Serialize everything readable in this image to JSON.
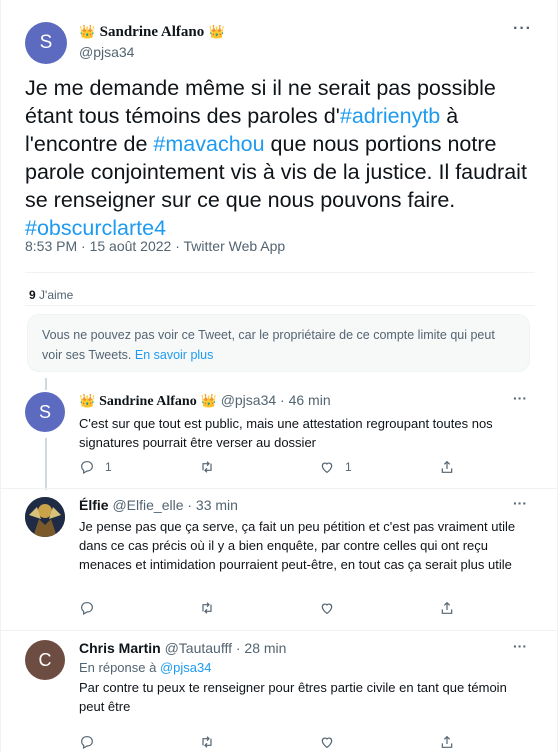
{
  "main_tweet": {
    "avatar_letter": "S",
    "display_name": "Sandrine Alfano",
    "crown_left": "👑",
    "crown_right": "👑",
    "handle": "@pjsa34",
    "more": "···",
    "text_1": "Je me demande même si il ne serait pas possible étant tous témoins des paroles d'",
    "hashtag_1": "#adrienytb",
    "text_2": " à l'encontre de ",
    "hashtag_2": "#mavachou",
    "text_3": " que nous portions notre parole conjointement vis à vis de la justice.  Il faudrait se renseigner sur ce que nous pouvons faire. ",
    "hashtag_3": "#obscurclarte4",
    "timestamp": "8:53 PM · 15 août 2022 · Twitter Web App",
    "likes_count": "9",
    "likes_label": " J'aime"
  },
  "notice": {
    "text": "Vous ne pouvez pas voir ce Tweet, car le propriétaire de ce compte limite qui peut voir ses Tweets. ",
    "link": "En savoir plus"
  },
  "replies": [
    {
      "avatar_letter": "S",
      "display_name": "Sandrine Alfano",
      "crown_left": "👑",
      "crown_right": "👑",
      "handle": "@pjsa34 · 46 min",
      "text": "C'est sur que tout est public, mais une attestation regroupant toutes nos signatures pourrait être verser au dossier",
      "reply_count": "1",
      "like_count": "1"
    },
    {
      "display_name": "Élfie",
      "handle": "@Elfie_elle · 33 min",
      "text": "Je pense pas que ça serve, ça fait un peu pétition et c'est pas vraiment utile dans ce cas précis où il y a bien enquête, par contre celles qui ont reçu menaces et intimidation pourraient peut-être, en tout cas ça serait plus utile"
    },
    {
      "avatar_letter": "C",
      "display_name": "Chris Martin",
      "handle": "@Tautaufff · 28 min",
      "in_reply_prefix": "En réponse à ",
      "in_reply_handle": "@pjsa34",
      "text": "Par contre tu peux te renseigner pour êtres partie civile en tant que témoin peut être"
    }
  ],
  "colors": {
    "accent": "#1d9bf0",
    "text": "#0f1419",
    "muted": "#536471"
  },
  "icons": [
    "reply-icon",
    "retweet-icon",
    "like-icon",
    "share-icon",
    "more-icon"
  ]
}
